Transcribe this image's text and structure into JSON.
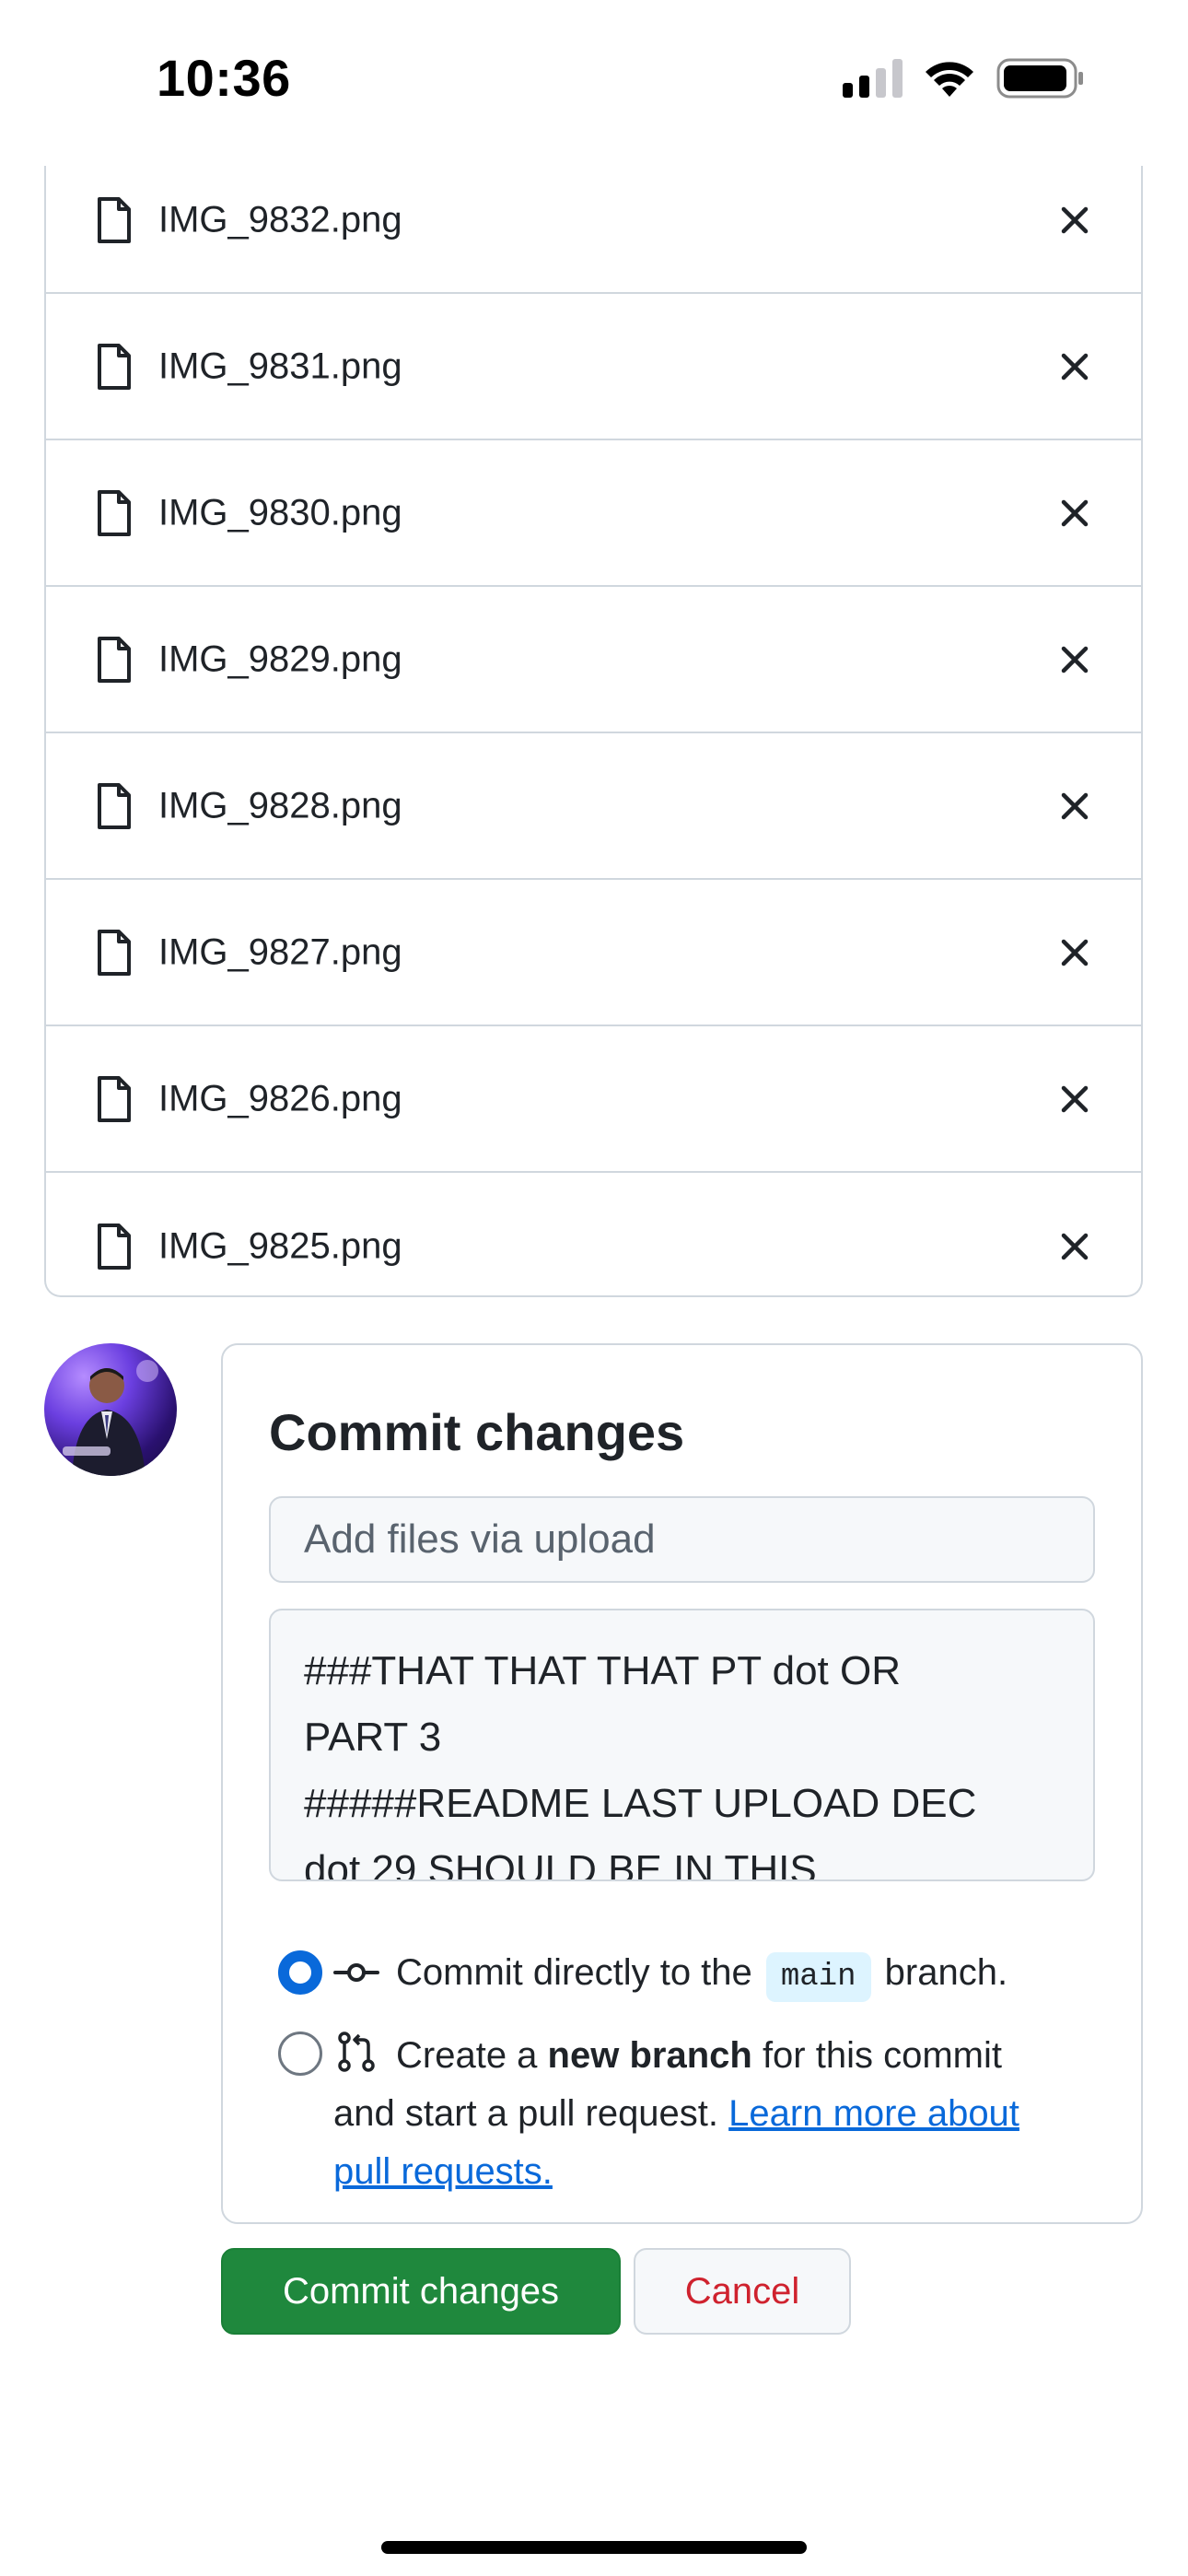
{
  "status_bar": {
    "time": "10:36",
    "icons": [
      "cellular-signal-icon",
      "wifi-icon",
      "battery-icon"
    ]
  },
  "files": [
    {
      "name": "IMG_9832.png"
    },
    {
      "name": "IMG_9831.png"
    },
    {
      "name": "IMG_9830.png"
    },
    {
      "name": "IMG_9829.png"
    },
    {
      "name": "IMG_9828.png"
    },
    {
      "name": "IMG_9827.png"
    },
    {
      "name": "IMG_9826.png"
    },
    {
      "name": "IMG_9825.png"
    }
  ],
  "commit": {
    "title": "Commit changes",
    "summary_placeholder": "Add files via upload",
    "description_lines": [
      "###THAT THAT THAT PT dot OR",
      "PART 3",
      "#####README LAST UPLOAD DEC",
      "dot 29 SHOULD BE IN THIS"
    ],
    "option_direct": {
      "prefix": "Commit directly to the",
      "branch": "main",
      "suffix": "branch.",
      "selected": true
    },
    "option_new_branch": {
      "prefix": "Create a",
      "bold": "new branch",
      "suffix": "for this commit",
      "line2": "and start a pull request.",
      "link_part1": "Learn more about",
      "link_part2": "pull requests.",
      "selected": false
    }
  },
  "buttons": {
    "commit": "Commit changes",
    "cancel": "Cancel"
  },
  "colors": {
    "primary_green": "#1f883d",
    "accent_blue": "#0969da",
    "danger_red": "#cf222e",
    "border": "#d0d7de"
  }
}
